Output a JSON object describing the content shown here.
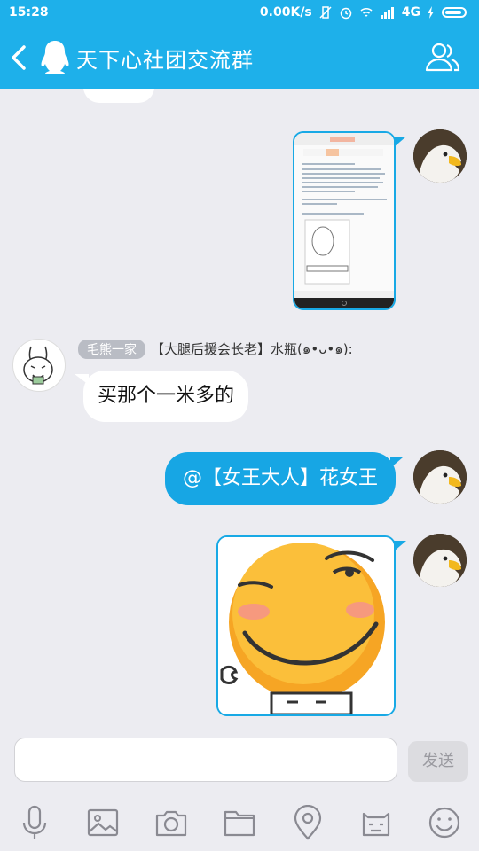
{
  "status_bar": {
    "time": "15:28",
    "speed": "0.00K/s",
    "network": "4G"
  },
  "header": {
    "title": "天下心社团交流群"
  },
  "messages": {
    "sender_badge": "毛熊一家",
    "sender_name": "【大腿后援会长老】水瓶(๑•ᴗ•๑):",
    "left_text": "买那个一米多的",
    "right_text": "@【女王大人】花女王"
  },
  "composer": {
    "input_value": "",
    "send_label": "发送"
  },
  "toolbar": {
    "items": [
      "mic-icon",
      "image-icon",
      "camera-icon",
      "folder-icon",
      "location-icon",
      "sticker-icon",
      "emoji-icon"
    ]
  },
  "colors": {
    "accent": "#1eb0ea",
    "outgoing_bubble": "#17a6e4",
    "background": "#ececf1"
  }
}
